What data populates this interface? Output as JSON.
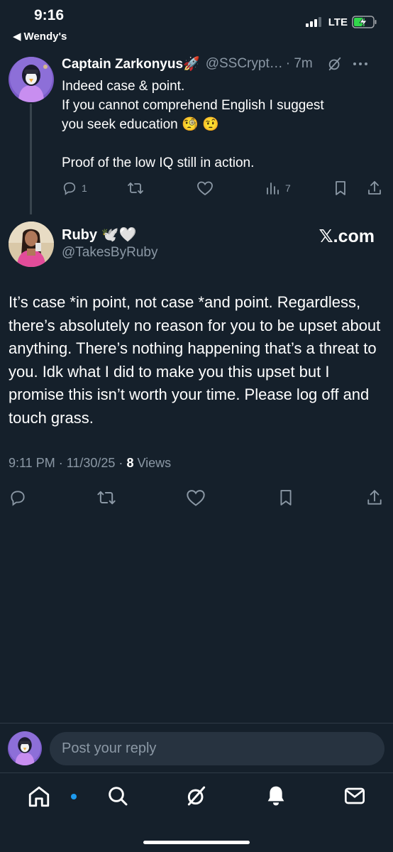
{
  "status_bar": {
    "time": "9:16",
    "back_app": "Wendy's",
    "network": "LTE"
  },
  "previous_tweet": {
    "display_name": "Captain Zarkonyus🚀",
    "handle": "@SSCrypt…",
    "time_ago": "· 7m",
    "text_lines": [
      "Indeed case & point.",
      "If you cannot comprehend English I suggest",
      "you seek education 🧐 🤨",
      "",
      "Proof of the low IQ still in action."
    ],
    "replies": "1",
    "views": "7"
  },
  "main_tweet": {
    "display_name": "Ruby 🕊️🤍",
    "handle": "@TakesByRuby",
    "watermark": "𝕏.com",
    "text": "It’s case *in point, not case *and point. Regardless, there’s absolutely no reason for you to be upset about anything. There’s nothing happening that’s a threat to you. Idk what I did to make you this upset but I promise this isn’t worth your time. Please log off and touch grass.",
    "time_date": "9:11 PM · 11/30/25 ·",
    "views_count": "8",
    "views_label": "Views"
  },
  "reply": {
    "placeholder": "Post your reply"
  },
  "colors": {
    "background": "#15202b",
    "muted": "#8b98a5",
    "accent": "#1d9bf0"
  },
  "icons": [
    "reply-icon",
    "retweet-icon",
    "like-icon",
    "views-icon",
    "bookmark-icon",
    "share-icon",
    "grok-icon",
    "more-icon",
    "home-icon",
    "search-icon",
    "bell-icon",
    "mail-icon"
  ]
}
